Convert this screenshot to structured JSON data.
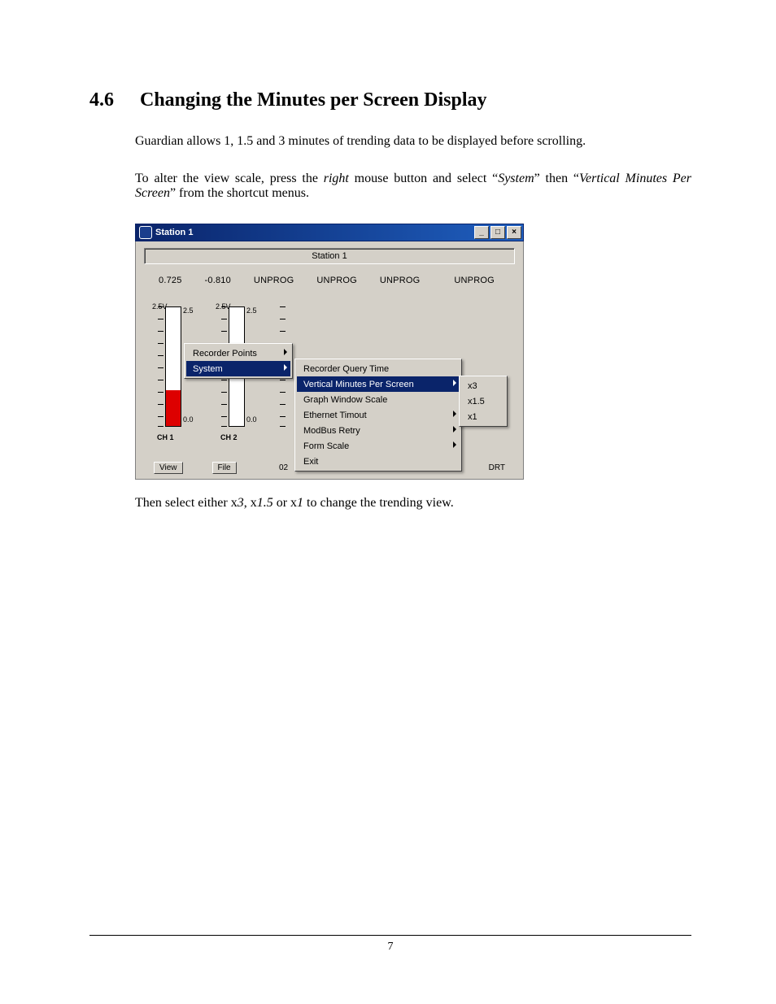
{
  "doc": {
    "section_number": "4.6",
    "section_title": "Changing the Minutes per Screen Display",
    "para1": "Guardian allows 1, 1.5 and 3 minutes of trending data to be displayed before scrolling.",
    "para2_a": "To alter the view scale, press the ",
    "para2_b": "right",
    "para2_c": " mouse button and select “",
    "para2_d": "System",
    "para2_e": "” then “",
    "para2_f": "Vertical Minutes Per Screen",
    "para2_g": "” from the shortcut menus.",
    "para3_a": "Then select either x",
    "para3_b": "3",
    "para3_c": ", x",
    "para3_d": "1.5",
    "para3_e": " or x",
    "para3_f": "1",
    "para3_g": " to change the trending view.",
    "page_number": "7"
  },
  "window": {
    "title": "Station 1",
    "panel_label": "Station 1",
    "readings": [
      "0.725",
      "-0.810",
      "UNPROG",
      "UNPROG",
      "UNPROG",
      "UNPROG"
    ],
    "gauges": [
      {
        "unit": "2.5V",
        "top": "2.5",
        "bot": "0.0",
        "name": "CH 1",
        "fill_pct": 30
      },
      {
        "unit": "2.5V",
        "top": "2.5",
        "bot": "0.0",
        "name": "CH 2",
        "fill_pct": 0
      }
    ],
    "menu1": [
      {
        "label": "Recorder Points",
        "arrow": true,
        "hi": false
      },
      {
        "label": "System",
        "arrow": true,
        "hi": true
      }
    ],
    "menu2": [
      {
        "label": "Recorder Query Time",
        "arrow": false,
        "hi": false
      },
      {
        "label": "Vertical Minutes Per Screen",
        "arrow": true,
        "hi": true
      },
      {
        "label": "Graph Window Scale",
        "arrow": false,
        "hi": false
      },
      {
        "label": "Ethernet Timout",
        "arrow": true,
        "hi": false
      },
      {
        "label": "ModBus Retry",
        "arrow": true,
        "hi": false
      },
      {
        "label": "Form Scale",
        "arrow": true,
        "hi": false
      },
      {
        "label": "Exit",
        "arrow": false,
        "hi": false
      }
    ],
    "menu3": [
      {
        "label": "x3"
      },
      {
        "label": "x1.5"
      },
      {
        "label": "x1"
      }
    ],
    "buttons": {
      "view": "View",
      "file": "File"
    },
    "status_mid": "02",
    "status_right": "DRT"
  }
}
